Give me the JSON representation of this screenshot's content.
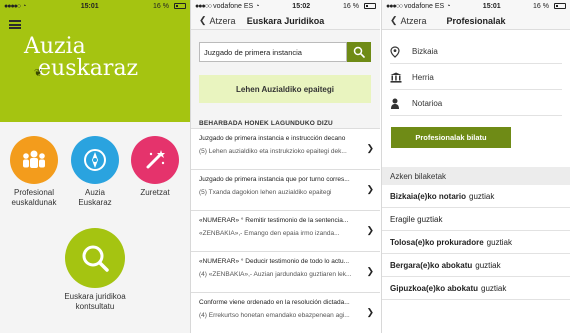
{
  "status": {
    "left_screen": {
      "time": "15:01",
      "battery": "16 %"
    },
    "mid_screen": {
      "carrier": "vodafone ES",
      "time": "15:02",
      "battery": "16 %"
    },
    "right_screen": {
      "carrier": "vodafone ES",
      "time": "15:01",
      "battery": "16 %"
    }
  },
  "home": {
    "logo_line1": "Auzia",
    "logo_line2": "euskaraz",
    "tiles": [
      {
        "label": "Profesional euskaldunak",
        "color": "#f39c1c",
        "icon": "people-icon"
      },
      {
        "label": "Auzia Euskaraz",
        "color": "#2aa3df",
        "icon": "compass-icon"
      },
      {
        "label": "Zuretzat",
        "color": "#e5336c",
        "icon": "magic-wand-icon"
      },
      {
        "label": "Euskara juridikoa kontsultatu",
        "color": "#a5c411",
        "icon": "search-icon"
      }
    ]
  },
  "juridical": {
    "back_label": "Atzera",
    "title": "Euskara Juridikoa",
    "search_value": "Juzgado de primera instancia",
    "result_banner": "Lehen Auzialdiko epaitegi",
    "section_title": "BEHARBADA HONEK LAGUNDUKO DIZU",
    "items": [
      {
        "line1": "Juzgado de primera instancia e instrucción decano",
        "line2": "(5) Lehen auzialdiko eta instrukzioko epaitegi dek..."
      },
      {
        "line1": "Juzgado de primera instancia que por turno corres...",
        "line2": "(5) Txanda dagokion lehen auzialdiko epaitegi"
      },
      {
        "line1": "«NUMERAR» ° Remitir testimonio de la sentencia...",
        "line2": "«ZENBAKIA»,- Emango den epaia irmo izanda..."
      },
      {
        "line1": "«NUMERAR» ° Deducir testimonio de todo lo actu...",
        "line2": "(4) «ZENBAKIA»,- Auzian jardundako guztiaren lek..."
      },
      {
        "line1": "Conforme viene ordenado en la resolución dictada...",
        "line2": "(4) Errekurtso honetan emandako ebazpenean agi..."
      }
    ]
  },
  "professionals": {
    "back_label": "Atzera",
    "title": "Profesionalak",
    "fields": [
      {
        "placeholder": "Bizkaia",
        "icon": "location-pin-icon"
      },
      {
        "placeholder": "Herria",
        "icon": "building-icon"
      },
      {
        "placeholder": "Notarioa",
        "icon": "person-icon"
      }
    ],
    "search_button": "Profesionalak bilatu",
    "recent_title": "Azken bilaketak",
    "recent": [
      {
        "bold": "Bizkaia(e)ko notario",
        "rest": "guztiak"
      },
      {
        "bold": "",
        "rest": "Eragile guztiak"
      },
      {
        "bold": "Tolosa(e)ko prokuradore",
        "rest": "guztiak"
      },
      {
        "bold": "Bergara(e)ko abokatu",
        "rest": "guztiak"
      },
      {
        "bold": "Gipuzkoa(e)ko abokatu",
        "rest": "guztiak"
      }
    ]
  }
}
